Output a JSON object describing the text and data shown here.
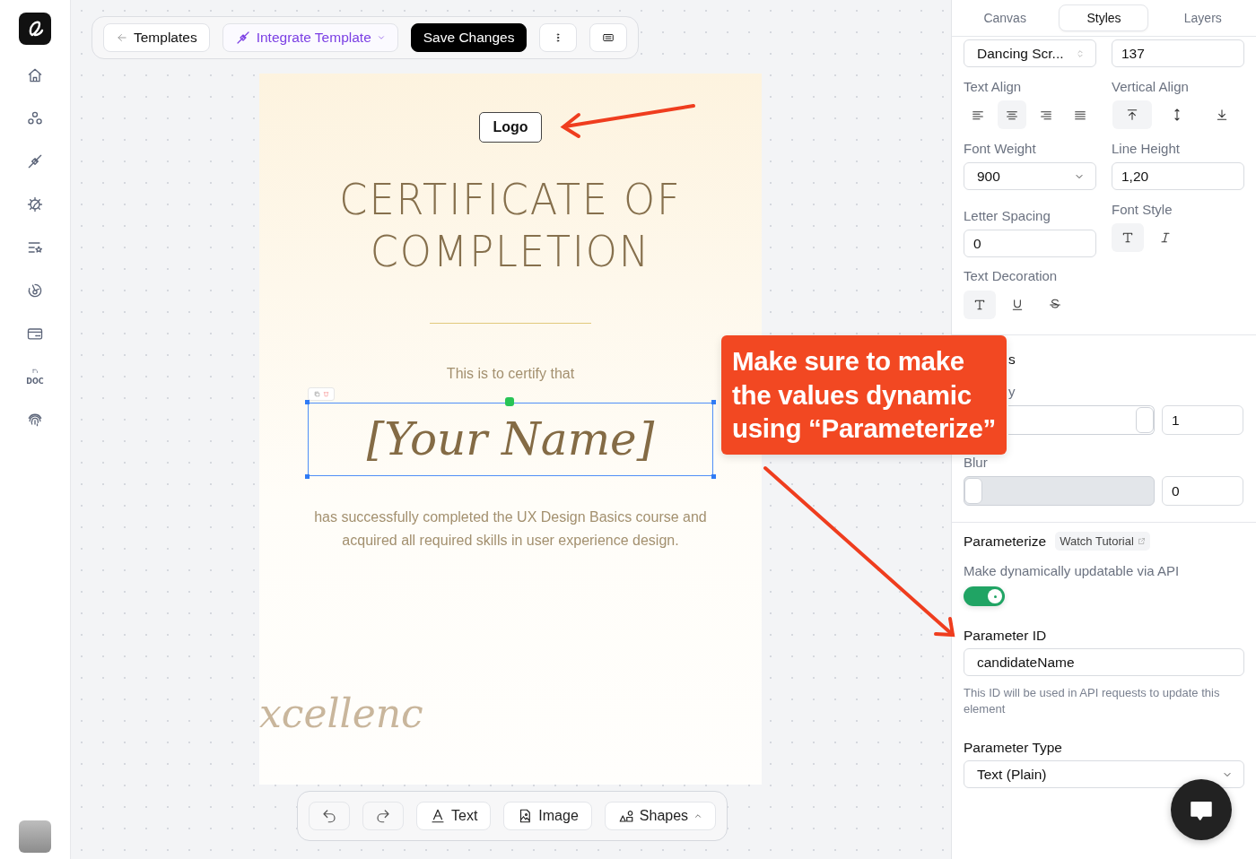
{
  "sidebar": {
    "items": [
      {
        "kind": "home"
      },
      {
        "kind": "circles"
      },
      {
        "kind": "plug"
      },
      {
        "kind": "gear"
      },
      {
        "kind": "list-star"
      },
      {
        "kind": "chart"
      },
      {
        "kind": "card"
      },
      {
        "kind": "doc",
        "label": "DOC"
      },
      {
        "kind": "fingerprint"
      }
    ]
  },
  "toolbar": {
    "back": "Templates",
    "integrate": "Integrate Template",
    "save": "Save Changes"
  },
  "certificate": {
    "logo": "Logo",
    "title_lines": [
      "CERTIFICATE OF",
      "COMPLETION"
    ],
    "intro": "This is to certify that",
    "name": "[Your Name]",
    "body": "has successfully completed the UX Design Basics course and acquired all required skills in user experience design.",
    "decoration": "xcellenc"
  },
  "bottom_bar": {
    "tools": [
      {
        "kind": "undo"
      },
      {
        "kind": "redo"
      },
      {
        "kind": "text",
        "label": "Text"
      },
      {
        "kind": "image",
        "label": "Image"
      },
      {
        "kind": "shapes",
        "label": "Shapes"
      }
    ]
  },
  "panel": {
    "tabs": [
      {
        "label": "Canvas",
        "selected": false
      },
      {
        "label": "Styles",
        "selected": true
      },
      {
        "label": "Layers",
        "selected": false
      }
    ],
    "font_family": "Dancing Scr...",
    "font_size": "137",
    "text_align": {
      "label": "Text Align",
      "options": [
        {
          "kind": "left",
          "selected": false
        },
        {
          "kind": "center",
          "selected": true
        },
        {
          "kind": "right",
          "selected": false
        },
        {
          "kind": "justify",
          "selected": false
        }
      ]
    },
    "vertical_align": {
      "label": "Vertical Align",
      "options": [
        {
          "kind": "top",
          "selected": true
        },
        {
          "kind": "middle",
          "selected": false
        },
        {
          "kind": "bottom",
          "selected": false
        }
      ]
    },
    "font_weight": {
      "label": "Font Weight",
      "value": "900"
    },
    "line_height": {
      "label": "Line Height",
      "value": "1,20"
    },
    "letter_spacing": {
      "label": "Letter Spacing",
      "value": "0"
    },
    "font_style": {
      "label": "Font Style",
      "options": [
        {
          "kind": "normal",
          "selected": true
        },
        {
          "kind": "italic",
          "selected": false
        }
      ]
    },
    "text_decoration": {
      "label": "Text Decoration",
      "options": [
        {
          "kind": "none",
          "selected": true
        },
        {
          "kind": "underline",
          "selected": false
        },
        {
          "kind": "strike",
          "selected": false
        }
      ]
    },
    "effects": {
      "title": "s",
      "sliders": [
        {
          "label": "y",
          "level": 1,
          "value": "1"
        },
        {
          "label": "Blur",
          "level": 0,
          "value": "0"
        }
      ]
    },
    "parameterize": {
      "title": "Parameterize",
      "tutorial": "Watch Tutorial",
      "description": "Make dynamically updatable via API",
      "on": true,
      "id_label": "Parameter ID",
      "id_value": "candidateName",
      "help": "This ID will be used in API requests to update this element",
      "type_label": "Parameter Type",
      "type_value": "Text (Plain)"
    }
  },
  "callout": {
    "text": "Make sure to make the values dynamic using “Parameterize”"
  }
}
